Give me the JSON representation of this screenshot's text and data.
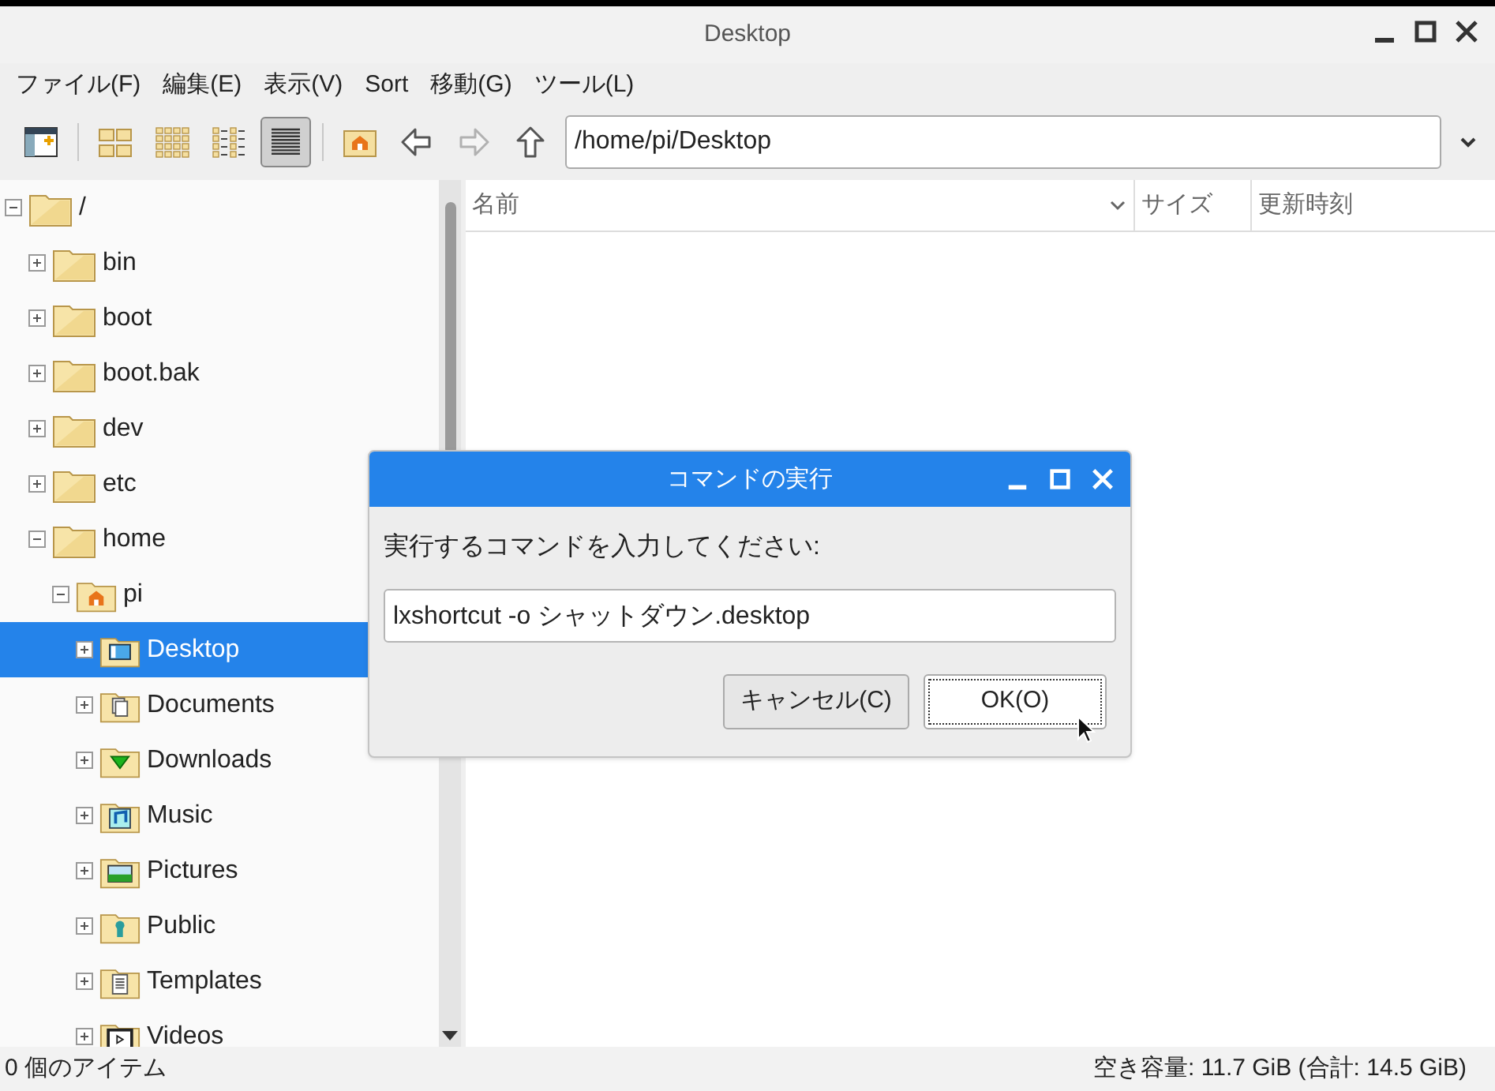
{
  "window": {
    "title": "Desktop"
  },
  "menu": [
    "ファイル(F)",
    "編集(E)",
    "表示(V)",
    "Sort",
    "移動(G)",
    "ツール(L)"
  ],
  "toolbar": [
    {
      "kind": "new-window",
      "selected": false,
      "disabled": false
    },
    {
      "kind": "sep"
    },
    {
      "kind": "icon-view",
      "selected": false,
      "disabled": false
    },
    {
      "kind": "thumbnail-view",
      "selected": false,
      "disabled": false
    },
    {
      "kind": "compact-view",
      "selected": false,
      "disabled": false
    },
    {
      "kind": "list-view",
      "selected": true,
      "disabled": false
    },
    {
      "kind": "sep"
    },
    {
      "kind": "home",
      "selected": false,
      "disabled": false
    },
    {
      "kind": "back",
      "selected": false,
      "disabled": false
    },
    {
      "kind": "forward",
      "selected": false,
      "disabled": true
    },
    {
      "kind": "up",
      "selected": false,
      "disabled": false
    }
  ],
  "location": {
    "value": "/home/pi/Desktop"
  },
  "tree": [
    {
      "label": "/",
      "kind": "folder",
      "expanded": true,
      "selected": false,
      "children": [
        {
          "label": "bin",
          "kind": "folder",
          "expanded": false,
          "selected": false
        },
        {
          "label": "boot",
          "kind": "folder",
          "expanded": false,
          "selected": false
        },
        {
          "label": "boot.bak",
          "kind": "folder",
          "expanded": false,
          "selected": false
        },
        {
          "label": "dev",
          "kind": "folder",
          "expanded": false,
          "selected": false
        },
        {
          "label": "etc",
          "kind": "folder",
          "expanded": false,
          "selected": false
        },
        {
          "label": "home",
          "kind": "folder",
          "expanded": true,
          "selected": false,
          "children": [
            {
              "label": "pi",
              "kind": "home",
              "expanded": true,
              "selected": false,
              "children": [
                {
                  "label": "Desktop",
                  "kind": "desktop",
                  "expanded": false,
                  "selected": true
                },
                {
                  "label": "Documents",
                  "kind": "documents",
                  "expanded": false,
                  "selected": false
                },
                {
                  "label": "Downloads",
                  "kind": "downloads",
                  "expanded": false,
                  "selected": false
                },
                {
                  "label": "Music",
                  "kind": "music",
                  "expanded": false,
                  "selected": false
                },
                {
                  "label": "Pictures",
                  "kind": "pictures",
                  "expanded": false,
                  "selected": false
                },
                {
                  "label": "Public",
                  "kind": "public",
                  "expanded": false,
                  "selected": false
                },
                {
                  "label": "Templates",
                  "kind": "templates",
                  "expanded": false,
                  "selected": false
                },
                {
                  "label": "Videos",
                  "kind": "videos",
                  "expanded": false,
                  "selected": false
                }
              ]
            }
          ]
        }
      ]
    }
  ],
  "columns": [
    {
      "label": "名前",
      "sorted": true
    },
    {
      "label": "サイズ",
      "sorted": false
    },
    {
      "label": "更新時刻",
      "sorted": false
    }
  ],
  "dialog": {
    "title": "コマンドの実行",
    "prompt": "実行するコマンドを入力してください:",
    "command": "lxshortcut -o シャットダウン.desktop",
    "buttons": [
      {
        "label": "キャンセル(C)",
        "focused": false
      },
      {
        "label": "OK(O)",
        "focused": true
      }
    ]
  },
  "status_bar": {
    "left": "0 個のアイテム",
    "right": "空き容量: 11.7 GiB (合計: 14.5 GiB)"
  }
}
